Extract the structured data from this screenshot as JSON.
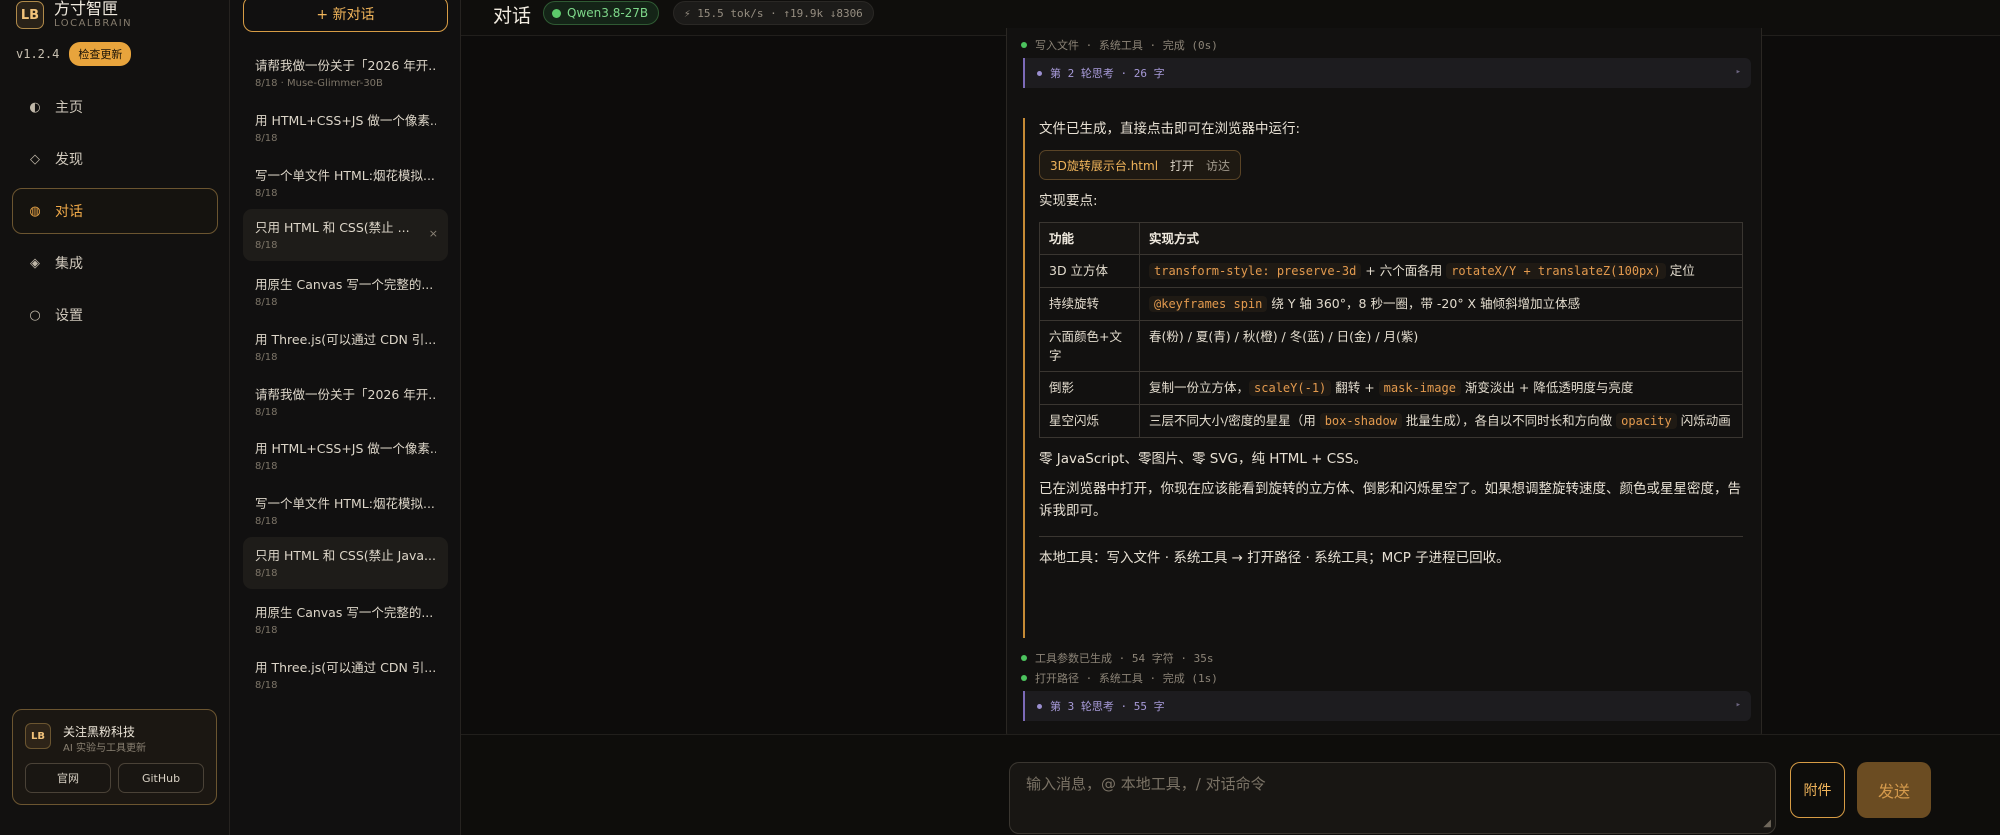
{
  "brand": {
    "logo": "LB",
    "name": "方寸智匣",
    "sub": "LOCALBRAIN",
    "version": "v1.2.4",
    "update_label": "检查更新"
  },
  "nav": [
    {
      "label": "主页",
      "icon": "◐"
    },
    {
      "label": "发现",
      "icon": "◇"
    },
    {
      "label": "对话",
      "icon": "◍"
    },
    {
      "label": "集成",
      "icon": "◈"
    },
    {
      "label": "设置",
      "icon": "○"
    }
  ],
  "follow": {
    "logo": "LB",
    "title": "关注黑粉科技",
    "subtitle": "AI 实验与工具更新",
    "site_label": "官网",
    "github_label": "GitHub"
  },
  "new_chat_label": "+ 新对话",
  "conversations": [
    {
      "title": "请帮我做一份关于「2026 年开...",
      "meta": "8/18 · Muse-Glimmer-30B"
    },
    {
      "title": "用 HTML+CSS+JS 做一个像素...",
      "meta": "8/18"
    },
    {
      "title": "写一个单文件 HTML:烟花模拟...",
      "meta": "8/18"
    },
    {
      "title": "只用 HTML 和 CSS(禁止 ...",
      "meta": "8/18",
      "close": "×"
    },
    {
      "title": "用原生 Canvas 写一个完整的...",
      "meta": "8/18"
    },
    {
      "title": "用 Three.js(可以通过 CDN 引...",
      "meta": "8/18"
    },
    {
      "title": "请帮我做一份关于「2026 年开...",
      "meta": "8/18"
    },
    {
      "title": "用 HTML+CSS+JS 做一个像素...",
      "meta": "8/18"
    },
    {
      "title": "写一个单文件 HTML:烟花模拟...",
      "meta": "8/18"
    },
    {
      "title": "只用 HTML 和 CSS(禁止 Java...",
      "meta": "8/18"
    },
    {
      "title": "用原生 Canvas 写一个完整的...",
      "meta": "8/18"
    },
    {
      "title": "用 Three.js(可以通过 CDN 引...",
      "meta": "8/18"
    }
  ],
  "header": {
    "title": "对话",
    "model": "Qwen3.8-27B",
    "stats": "⚡ 15.5 tok/s · ↑19.9k ↓8306"
  },
  "message": {
    "step_write": "写入文件 · 系统工具 · 完成 (0s)",
    "think_2": "第 2 轮思考 · 26 字",
    "intro": "文件已生成，直接点击即可在浏览器中运行:",
    "file": {
      "name": "3D旋转展示台.html",
      "open_label": "打开",
      "reveal_label": "访达"
    },
    "points_title": "实现要点:",
    "table": {
      "headers": [
        "功能",
        "实现方式"
      ],
      "rows": [
        {
          "feature": "3D 立方体",
          "code1": "transform-style: preserve-3d",
          "text1": " + 六个面各用 ",
          "code2": "rotateX/Y + translateZ(100px)",
          "text2": " 定位"
        },
        {
          "feature": "持续旋转",
          "code1": "@keyframes spin",
          "text1": " 绕 Y 轴 360°，8 秒一圈，带 -20° X 轴倾斜增加立体感",
          "code2": "",
          "text2": ""
        },
        {
          "feature": "六面颜色+文字",
          "code1": "",
          "text1": "春(粉) / 夏(青) / 秋(橙) / 冬(蓝) / 日(金) / 月(紫)",
          "code2": "",
          "text2": ""
        },
        {
          "feature": "倒影",
          "text0": "复制一份立方体，",
          "code1": "scaleY(-1)",
          "text1": " 翻转 + ",
          "code2": "mask-image",
          "text2": " 渐变淡出 + 降低透明度与亮度"
        },
        {
          "feature": "星空闪烁",
          "text0": "三层不同大小/密度的星星（用 ",
          "code1": "box-shadow",
          "text1": " 批量生成），各自以不同时长和方向做 ",
          "code2": "opacity",
          "text2": " 闪烁动画"
        }
      ]
    },
    "note1": "零 JavaScript、零图片、零 SVG，纯 HTML + CSS。",
    "note2": "已在浏览器中打开，你现在应该能看到旋转的立方体、倒影和闪烁星空了。如果想调整旋转速度、颜色或星星密度，告诉我即可。",
    "tools_line": "本地工具：写入文件 · 系统工具 → 打开路径 · 系统工具；MCP 子进程已回收。",
    "step_params": "工具参数已生成 · 54 字符 · 35s",
    "step_open": "打开路径 · 系统工具 · 完成 (1s)",
    "think_3": "第 3 轮思考 · 55 字"
  },
  "composer": {
    "placeholder": "输入消息，@ 本地工具，/ 对话命令",
    "attach_label": "附件",
    "send_label": "发送"
  }
}
